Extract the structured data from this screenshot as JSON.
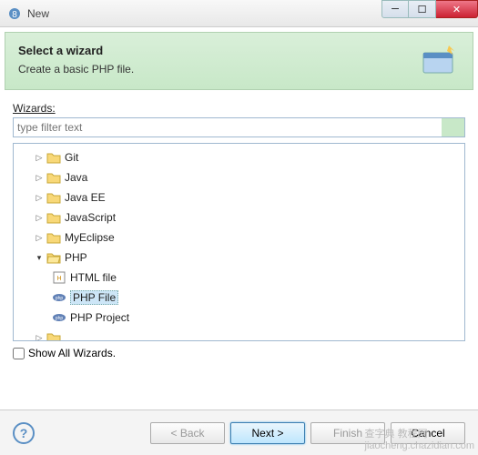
{
  "window": {
    "title": "New"
  },
  "banner": {
    "heading": "Select a wizard",
    "subtitle": "Create a basic PHP file."
  },
  "filter": {
    "label": "Wizards:",
    "placeholder": "type filter text"
  },
  "tree": {
    "items": [
      {
        "label": "Git",
        "expanded": false,
        "level": 1
      },
      {
        "label": "Java",
        "expanded": false,
        "level": 1
      },
      {
        "label": "Java EE",
        "expanded": false,
        "level": 1
      },
      {
        "label": "JavaScript",
        "expanded": false,
        "level": 1
      },
      {
        "label": "MyEclipse",
        "expanded": false,
        "level": 1
      },
      {
        "label": "PHP",
        "expanded": true,
        "level": 1
      },
      {
        "label": "HTML file",
        "icon": "html",
        "level": 2
      },
      {
        "label": "PHP File",
        "icon": "php",
        "level": 2,
        "selected": true
      },
      {
        "label": "PHP Project",
        "icon": "php-proj",
        "level": 2
      }
    ]
  },
  "showAll": {
    "label": "Show All Wizards."
  },
  "buttons": {
    "back": "< Back",
    "next": "Next >",
    "finish": "Finish",
    "cancel": "Cancel"
  },
  "watermark": "jiaocheng.chazidian.com",
  "watermark2": "查字典 教程网"
}
